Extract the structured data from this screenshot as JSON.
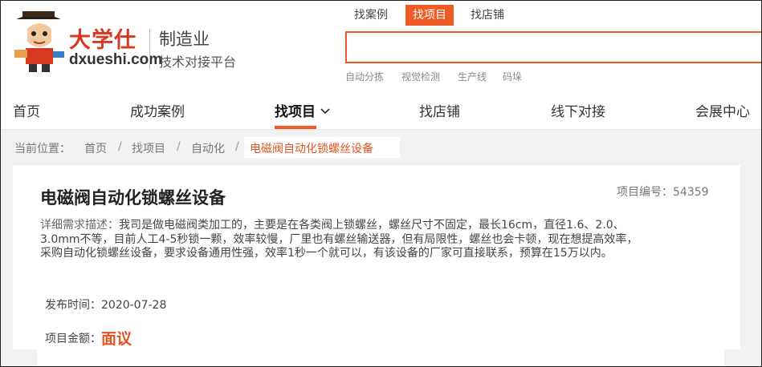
{
  "logo": {
    "brand_cn": "大学仕",
    "brand_en": "dxueshi.com",
    "sub_title": "制造业",
    "sub_tagline": "技术对接平台",
    "colors": {
      "brand": "#d6391f",
      "accent": "#ef5b25"
    }
  },
  "search": {
    "tabs": [
      {
        "label": "找案例"
      },
      {
        "label": "找项目",
        "active": true
      },
      {
        "label": "找店铺"
      }
    ],
    "value": "",
    "hot_words": [
      "自动分拣",
      "视觉检测",
      "生产线",
      "码垛"
    ]
  },
  "nav": {
    "items": [
      {
        "label": "首页"
      },
      {
        "label": "成功案例"
      },
      {
        "label": "找项目",
        "active": true,
        "icon": "chevron-down-icon"
      },
      {
        "label": "找店铺"
      },
      {
        "label": "线下对接"
      },
      {
        "label": "会展中心"
      }
    ]
  },
  "breadcrumb": {
    "prefix": "当前位置：",
    "items": [
      "首页",
      "找项目",
      "自动化"
    ],
    "separator": "/",
    "current": "电磁阀自动化锁螺丝设备"
  },
  "project": {
    "title": "电磁阀自动化锁螺丝设备",
    "number": "项目编号：54359",
    "desc_label": "详细需求描述：",
    "desc_lines": [
      "我司是做电磁阀类加工的，主要是在各类阀上锁螺丝，螺丝尺寸不固定，最长16cm，直径1.6、2.0、",
      "3.0mm不等，目前人工4-5秒锁一颗，效率较慢，厂里也有螺丝输送器，但有局限性，螺丝也会卡顿，现在想提高效率，",
      "采购自动化锁螺丝设备，要求设备通用性强，效率1秒一个就可以，有该设备的厂家可直接联系，预算在15万以内。"
    ],
    "publish_time": "发布时间：2020-07-28",
    "amount_label": "项目金额：",
    "amount_value": "面议"
  }
}
